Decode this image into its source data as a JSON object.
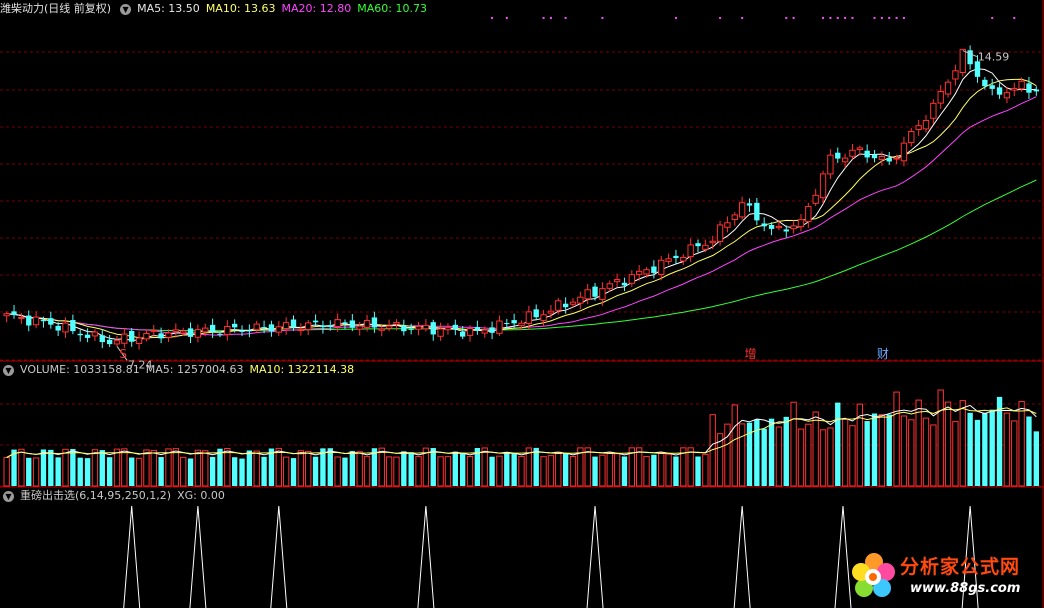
{
  "stock_name": "潍柴动力",
  "period_label": "(日线 前复权)",
  "price_indicators": [
    {
      "label": "MA5: 13.50",
      "color": "#ffffff"
    },
    {
      "label": "MA10: 13.63",
      "color": "#ffff66"
    },
    {
      "label": "MA20: 12.80",
      "color": "#ff44ff"
    },
    {
      "label": "MA60: 10.73",
      "color": "#33ff33"
    }
  ],
  "volume_indicators": [
    {
      "label": "VOLUME: 1033158.81",
      "color": "#c8c8c8"
    },
    {
      "label": "MA5: 1257004.63",
      "color": "#c8c8c8"
    },
    {
      "label": "MA10: 1322114.38",
      "color": "#ffff66"
    }
  ],
  "formula_name": "重磅出击选",
  "formula_params": "(6,14,95,250,1,2)",
  "formula_value": "XG: 0.00",
  "high_marker": "14.59",
  "low_marker": "7.24",
  "event_markers": [
    "S",
    "增",
    "财"
  ],
  "watermark_title": "分析家公式网",
  "watermark_url": "www.88gs.com",
  "colors": {
    "up": "#ff3232",
    "down": "#54ffff",
    "grid": "#7a0000",
    "ma5": "#ffffff",
    "ma10": "#ffff66",
    "ma20": "#ff44ff",
    "ma60": "#33ff33"
  },
  "chart_data": [
    {
      "type": "candlestick",
      "title": "潍柴动力 (日线 前复权)",
      "y_range": [
        6.9,
        15.4
      ],
      "high": 14.59,
      "low": 7.24,
      "last_values": {
        "MA5": 13.5,
        "MA10": 13.63,
        "MA20": 12.8,
        "MA60": 10.73
      },
      "series": [
        "MA5",
        "MA10",
        "MA20",
        "MA60"
      ],
      "grid": true
    },
    {
      "type": "bar",
      "title": "VOLUME",
      "last_values": {
        "VOLUME": 1033158.81,
        "MA5": 1257004.63,
        "MA10": 1322114.38
      }
    },
    {
      "type": "line",
      "title": "重磅出击选(6,14,95,250,1,2)",
      "last_values": {
        "XG": 0.0
      }
    }
  ]
}
